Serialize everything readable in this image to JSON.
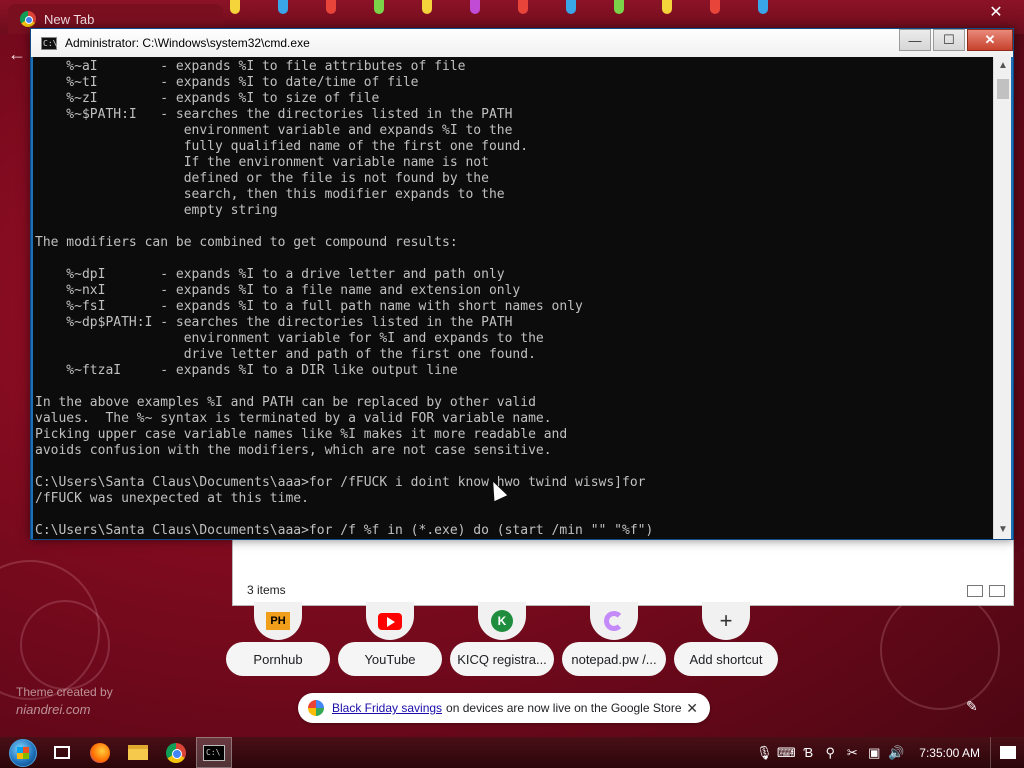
{
  "chrome": {
    "tab_title": "New Tab"
  },
  "cmd": {
    "title": "Administrator: C:\\Windows\\system32\\cmd.exe",
    "icon_text": "C:\\",
    "minimize": "—",
    "maximize": "☐",
    "close": "✕",
    "output": "    %~aI        - expands %I to file attributes of file\n    %~tI        - expands %I to date/time of file\n    %~zI        - expands %I to size of file\n    %~$PATH:I   - searches the directories listed in the PATH\n                   environment variable and expands %I to the\n                   fully qualified name of the first one found.\n                   If the environment variable name is not\n                   defined or the file is not found by the\n                   search, then this modifier expands to the\n                   empty string\n\nThe modifiers can be combined to get compound results:\n\n    %~dpI       - expands %I to a drive letter and path only\n    %~nxI       - expands %I to a file name and extension only\n    %~fsI       - expands %I to a full path name with short names only\n    %~dp$PATH:I - searches the directories listed in the PATH\n                   environment variable for %I and expands to the\n                   drive letter and path of the first one found.\n    %~ftzaI     - expands %I to a DIR like output line\n\nIn the above examples %I and PATH can be replaced by other valid\nvalues.  The %~ syntax is terminated by a valid FOR variable name.\nPicking upper case variable names like %I makes it more readable and\navoids confusion with the modifiers, which are not case sensitive.\n\nC:\\Users\\Santa Claus\\Documents\\aaa>for /fFUCK i doint know hwo twind wisws]for\n/fFUCK was unexpected at this time.\n\nC:\\Users\\Santa Claus\\Documents\\aaa>for /f %f in (*.exe) do (start /min \"\" \"%f\")"
  },
  "explorer": {
    "items_count": "3 items"
  },
  "shortcuts": [
    {
      "label": "Pornhub",
      "icon": "pornhub-icon",
      "icon_text": "PH"
    },
    {
      "label": "YouTube",
      "icon": "youtube-icon"
    },
    {
      "label": "KICQ registra...",
      "icon": "kicq-icon",
      "icon_text": "K"
    },
    {
      "label": "notepad.pw /...",
      "icon": "notepad-icon"
    },
    {
      "label": "Add shortcut",
      "icon": "plus-icon",
      "icon_text": "+"
    }
  ],
  "theme_credit": {
    "line1": "Theme created by",
    "line2": "niandrei.com"
  },
  "promo": {
    "link_text": "Black Friday savings",
    "text": "on devices are now live on the Google Store",
    "close": "✕"
  },
  "taskbar": {
    "clock": "7:35:00 AM",
    "tray_icons": [
      "mic-icon",
      "keyboard-icon",
      "ime-icon",
      "search-icon",
      "wrench-icon",
      "network-icon",
      "volume-icon"
    ]
  }
}
